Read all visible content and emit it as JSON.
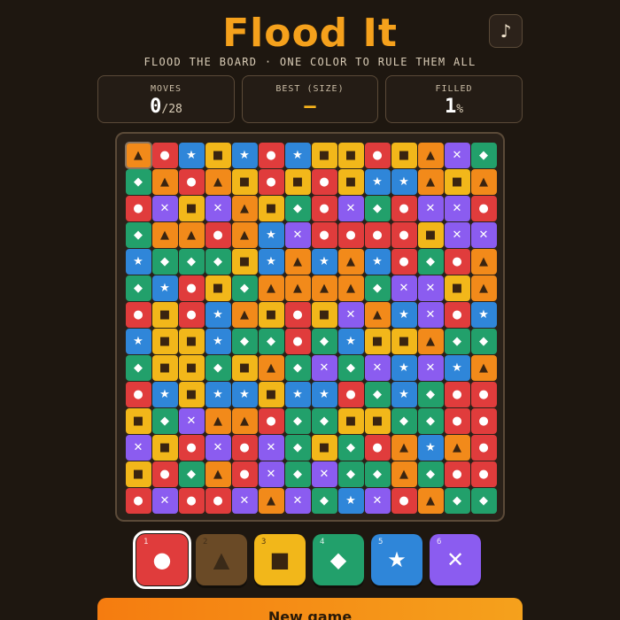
{
  "header": {
    "title": "Flood It",
    "subtitle": "FLOOD THE BOARD · ONE COLOR TO RULE THEM ALL",
    "music_icon": "music-note-icon",
    "music_glyph": "♪"
  },
  "stats": {
    "moves_label": "MOVES",
    "moves_value": "0",
    "moves_max": "/28",
    "best_label": "BEST (SIZE)",
    "best_value": "–",
    "filled_label": "FILLED",
    "filled_value": "1",
    "filled_unit": "%"
  },
  "colors": {
    "red": "#e03c3c",
    "orange": "#f28a1a",
    "yellow": "#f2b71a",
    "green": "#22a06b",
    "blue": "#2f86d9",
    "purple": "#8b5cf0",
    "accent": "#f5a11c"
  },
  "symbols": [
    "●",
    "▲",
    "■",
    "◆",
    "★",
    "✕"
  ],
  "board": {
    "size": 14,
    "rows": [
      [
        1,
        0,
        4,
        2,
        4,
        0,
        4,
        2,
        2,
        0,
        2,
        1,
        5,
        3
      ],
      [
        3,
        1,
        0,
        1,
        2,
        0,
        2,
        0,
        2,
        4,
        4,
        1,
        2,
        1
      ],
      [
        0,
        5,
        2,
        5,
        1,
        2,
        3,
        0,
        5,
        3,
        0,
        5,
        5,
        0
      ],
      [
        3,
        1,
        1,
        0,
        1,
        4,
        5,
        0,
        0,
        0,
        0,
        2,
        5,
        5
      ],
      [
        4,
        3,
        3,
        3,
        2,
        4,
        1,
        4,
        1,
        4,
        0,
        3,
        0,
        1
      ],
      [
        3,
        4,
        0,
        2,
        3,
        1,
        1,
        1,
        1,
        3,
        5,
        5,
        2,
        1
      ],
      [
        0,
        2,
        0,
        4,
        1,
        2,
        0,
        2,
        5,
        1,
        4,
        5,
        0,
        4
      ],
      [
        4,
        2,
        2,
        4,
        3,
        3,
        0,
        3,
        4,
        2,
        2,
        1,
        3,
        3
      ],
      [
        3,
        2,
        2,
        3,
        2,
        1,
        3,
        5,
        3,
        5,
        4,
        5,
        4,
        1
      ],
      [
        0,
        4,
        2,
        4,
        4,
        2,
        4,
        4,
        0,
        3,
        4,
        3,
        0,
        0
      ],
      [
        2,
        3,
        5,
        1,
        1,
        0,
        3,
        3,
        2,
        2,
        3,
        3,
        0,
        0
      ],
      [
        5,
        2,
        0,
        5,
        0,
        5,
        3,
        2,
        3,
        0,
        1,
        4,
        1,
        0
      ],
      [
        2,
        0,
        3,
        1,
        0,
        5,
        3,
        5,
        3,
        3,
        1,
        3,
        0,
        0
      ],
      [
        0,
        5,
        0,
        0,
        5,
        1,
        5,
        3,
        4,
        5,
        0,
        1,
        3,
        3
      ]
    ]
  },
  "palette": [
    {
      "num": "1",
      "color": "red",
      "glyph": "●",
      "icon": "circle-icon",
      "state": "active"
    },
    {
      "num": "2",
      "color": "orange",
      "glyph": "▲",
      "icon": "triangle-icon",
      "state": "current"
    },
    {
      "num": "3",
      "color": "yellow",
      "glyph": "■",
      "icon": "square-icon",
      "state": "normal"
    },
    {
      "num": "4",
      "color": "green",
      "glyph": "◆",
      "icon": "diamond-icon",
      "state": "normal"
    },
    {
      "num": "5",
      "color": "blue",
      "glyph": "★",
      "icon": "star-icon",
      "state": "normal"
    },
    {
      "num": "6",
      "color": "purple",
      "glyph": "✕",
      "icon": "x-icon",
      "state": "normal"
    }
  ],
  "new_game_label": "New game"
}
